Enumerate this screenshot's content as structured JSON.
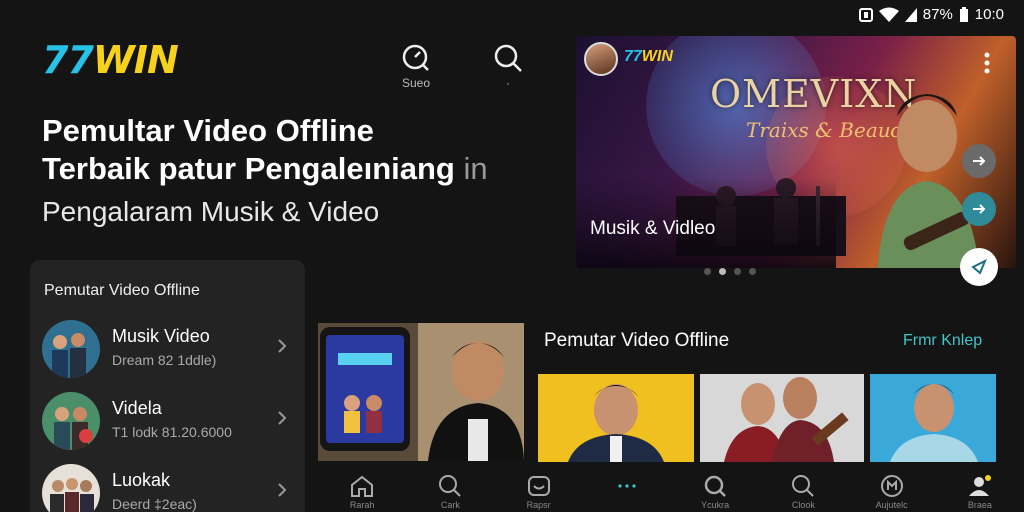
{
  "status": {
    "battery": "87%",
    "time": "10:0"
  },
  "brand": {
    "logo_numbers": "77",
    "logo_word": "WIN"
  },
  "header": {
    "icon1_label": "Sueo",
    "icon2_label": "·"
  },
  "hero": {
    "title_line1": "Pemultar Video Offline",
    "title_line2": "Terbaik patur Pengaleıniang",
    "title_trail": "in",
    "subtitle": "Pengalaram Musik & Video"
  },
  "banner": {
    "logo": "77WIN",
    "band_title": "OMEVIXN",
    "band_sub": "Traixs & Beaud",
    "tag": "Musik & Vidleo",
    "dots": [
      false,
      true,
      false,
      false
    ]
  },
  "panel": {
    "title": "Pemutar Video Offline",
    "items": [
      {
        "title": "Musik Video",
        "subtitle": "Dream 82 1ddle)"
      },
      {
        "title": "Videla",
        "subtitle": "T1 lodk 81.20.6000"
      },
      {
        "title": "Luokak",
        "subtitle": "Deerd ‡2eac)"
      }
    ]
  },
  "section": {
    "title": "Pemutar Video Offline",
    "link": "Frmr Knlep"
  },
  "nav": {
    "items": [
      {
        "icon": "home-icon",
        "label": "Rarah"
      },
      {
        "icon": "search-icon",
        "label": "Cark"
      },
      {
        "icon": "library-icon",
        "label": "Rapsr"
      },
      {
        "icon": "more-dots-icon",
        "label": ""
      },
      {
        "icon": "discover-icon",
        "label": "Ycukra"
      },
      {
        "icon": "search-alt-icon",
        "label": "Clook"
      },
      {
        "icon": "music-app-icon",
        "label": "Aujutelc"
      },
      {
        "icon": "profile-icon",
        "label": "Braea"
      }
    ]
  },
  "colors": {
    "accent": "#3ec6c9",
    "logo_yellow": "#f6d21e",
    "logo_cyan": "#27c3e6",
    "background": "#141414"
  }
}
